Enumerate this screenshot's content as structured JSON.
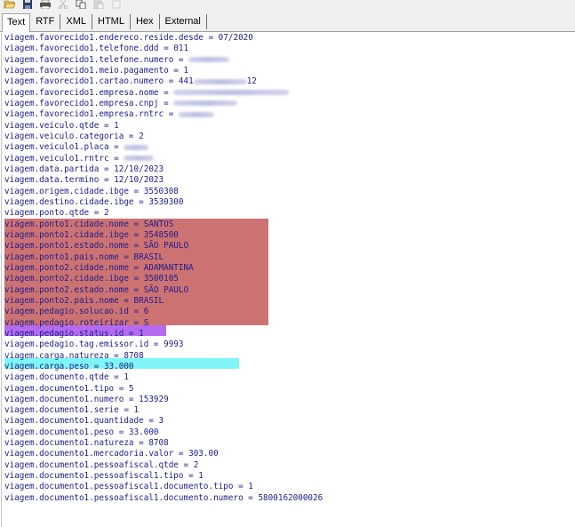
{
  "tabs": [
    {
      "label": "Text",
      "active": true
    },
    {
      "label": "RTF",
      "active": false
    },
    {
      "label": "XML",
      "active": false
    },
    {
      "label": "HTML",
      "active": false
    },
    {
      "label": "Hex",
      "active": false
    },
    {
      "label": "External",
      "active": false
    }
  ],
  "toolbar_icons": [
    "open-folder-icon",
    "save-icon",
    "print-icon",
    "cut-icon",
    "copy-icon",
    "paste-icon",
    "clear-icon"
  ],
  "colors": {
    "text": "#1d1d8c",
    "highlight_red": "#cd7272",
    "highlight_purple": "#b46bf0",
    "highlight_cyan": "#7ef5f8"
  },
  "lines": [
    {
      "text": "viagem.favorecido1.endereco.reside.desde = 07/2020"
    },
    {
      "text": "viagem.favorecido1.telefone.ddd = 011"
    },
    {
      "text": "viagem.favorecido1.telefone.numero = ",
      "blur": 46
    },
    {
      "text": "viagem.favorecido1.meio.pagamento = 1"
    },
    {
      "text": "viagem.favorecido1.cartao.numero = 441",
      "blur": 60,
      "suffix": "12"
    },
    {
      "text": "viagem.favorecido1.empresa.nome = ",
      "blur": 130
    },
    {
      "text": "viagem.favorecido1.empresa.cnpj = ",
      "blur": 72
    },
    {
      "text": "viagem.favorecido1.empresa.rntrc = ",
      "blur": 40
    },
    {
      "text": "viagem.veiculo.qtde = 1"
    },
    {
      "text": "viagem.veiculo.categoria = 2"
    },
    {
      "text": "viagem.veiculo1.placa = ",
      "blur": 28
    },
    {
      "text": "viagem.veiculo1.rntrc = ",
      "blur": 34
    },
    {
      "text": "viagem.data.partida = 12/10/2023"
    },
    {
      "text": "viagem.data.termino = 12/10/2023"
    },
    {
      "text": "viagem.origem.cidade.ibge = 3550308"
    },
    {
      "text": "viagem.destino.cidade.ibge = 3530300"
    },
    {
      "text": "viagem.ponto.qtde = 2"
    },
    {
      "text": "viagem.ponto1.cidade.nome = SANTOS"
    },
    {
      "text": "viagem.ponto1.cidade.ibge = 3548500"
    },
    {
      "text": "viagem.ponto1.estado.nome = SÃO PAULO"
    },
    {
      "text": "viagem.ponto1.pais.nome = BRASIL"
    },
    {
      "text": "viagem.ponto2.cidade.nome = ADAMANTINA"
    },
    {
      "text": "viagem.ponto2.cidade.ibge = 3500105"
    },
    {
      "text": "viagem.ponto2.estado.nome = SÃO PAULO"
    },
    {
      "text": "viagem.ponto2.pais.nome = BRASIL"
    },
    {
      "text": "viagem.pedagio.solucao.id = 6"
    },
    {
      "text": "viagem.pedagio.roteirizar = S"
    },
    {
      "text": "viagem.pedagio.status.id = 1"
    },
    {
      "text": "viagem.pedagio.tag.emissor.id = 9993"
    },
    {
      "text": "viagem.carga.natureza = 8708"
    },
    {
      "text": "viagem.carga.peso = 33.000"
    },
    {
      "text": "viagem.documento.qtde = 1"
    },
    {
      "text": "viagem.documento1.tipo = 5"
    },
    {
      "text": "viagem.documento1.numero = 153929"
    },
    {
      "text": "viagem.documento1.serie = 1"
    },
    {
      "text": "viagem.documento1.quantidade = 3"
    },
    {
      "text": "viagem.documento1.peso = 33.000"
    },
    {
      "text": "viagem.documento1.natureza = 8708"
    },
    {
      "text": "viagem.documento1.mercadoria.valor = 303.00"
    },
    {
      "text": "viagem.documento1.pessoafiscal.qtde = 2"
    },
    {
      "text": "viagem.documento1.pessoafiscal1.tipo = 1"
    },
    {
      "text": "viagem.documento1.pessoafiscal1.documento.tipo = 1"
    },
    {
      "text": "viagem.documento1.pessoafiscal1.documento.numero = 5800162000026"
    }
  ]
}
